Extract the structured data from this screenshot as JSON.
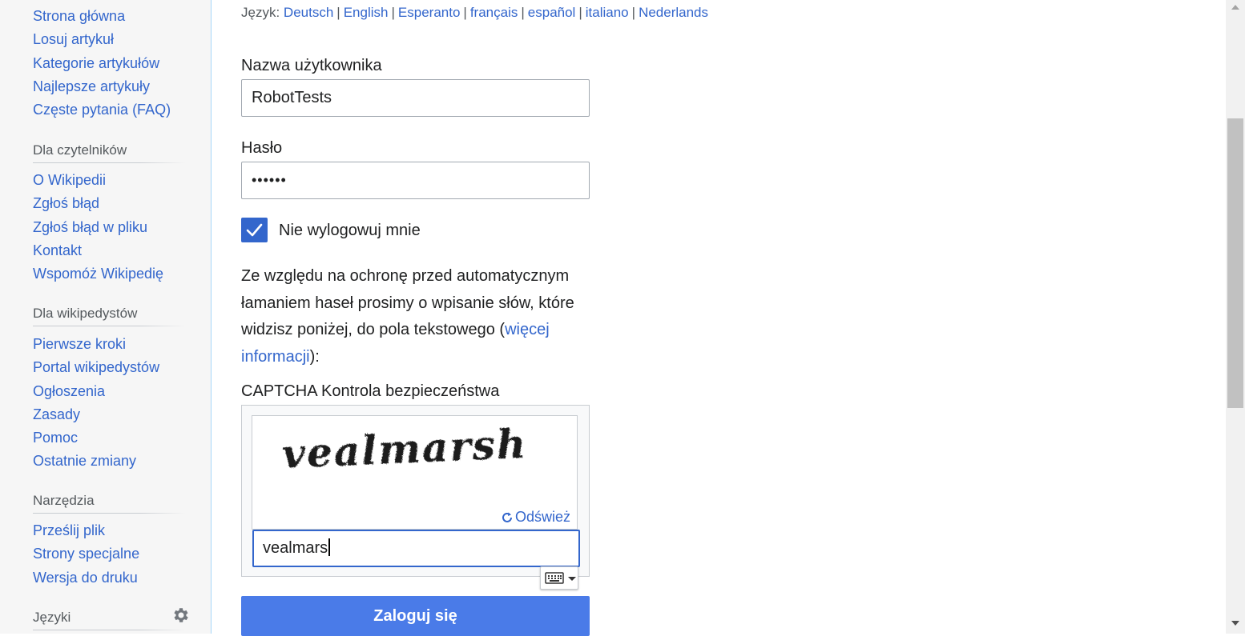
{
  "sidebar": {
    "navigation": [
      {
        "label": "Strona główna"
      },
      {
        "label": "Losuj artykuł"
      },
      {
        "label": "Kategorie artykułów"
      },
      {
        "label": "Najlepsze artykuły"
      },
      {
        "label": "Częste pytania (FAQ)"
      }
    ],
    "readers": {
      "heading": "Dla czytelników",
      "items": [
        {
          "label": "O Wikipedii"
        },
        {
          "label": "Zgłoś błąd"
        },
        {
          "label": "Zgłoś błąd w pliku"
        },
        {
          "label": "Kontakt"
        },
        {
          "label": "Wspomóż Wikipedię"
        }
      ]
    },
    "editors": {
      "heading": "Dla wikipedystów",
      "items": [
        {
          "label": "Pierwsze kroki"
        },
        {
          "label": "Portal wikipedystów"
        },
        {
          "label": "Ogłoszenia"
        },
        {
          "label": "Zasady"
        },
        {
          "label": "Pomoc"
        },
        {
          "label": "Ostatnie zmiany"
        }
      ]
    },
    "tools": {
      "heading": "Narzędzia",
      "items": [
        {
          "label": "Prześlij plik"
        },
        {
          "label": "Strony specjalne"
        },
        {
          "label": "Wersja do druku"
        }
      ]
    },
    "languages": {
      "heading": "Języki",
      "settings_icon": "gear-icon"
    }
  },
  "language_line": {
    "prefix": "Język:",
    "languages": [
      "Deutsch",
      "English",
      "Esperanto",
      "français",
      "español",
      "italiano",
      "Nederlands"
    ],
    "separator": "|"
  },
  "login_form": {
    "username_label": "Nazwa użytkownika",
    "username_value": "RobotTests",
    "password_label": "Hasło",
    "password_value": "••••••",
    "remember_label": "Nie wylogowuj mnie",
    "remember_checked": true,
    "info_text_before": "Ze względu na ochronę przed automatycznym łamaniem haseł prosimy o wpisanie słów, które widzisz poniżej, do pola tekstowego (",
    "info_link": "więcej informacji",
    "info_text_after": "):",
    "captcha_label": "CAPTCHA Kontrola bezpieczeństwa",
    "captcha_image_word": "vealmarsh",
    "refresh_label": "Odśwież",
    "captcha_input_value": "vealmars",
    "submit_label": "Zaloguj się"
  },
  "colors": {
    "link": "#3366cc",
    "button": "#4a7be8",
    "sidebar_bg": "#f6f6f6"
  }
}
